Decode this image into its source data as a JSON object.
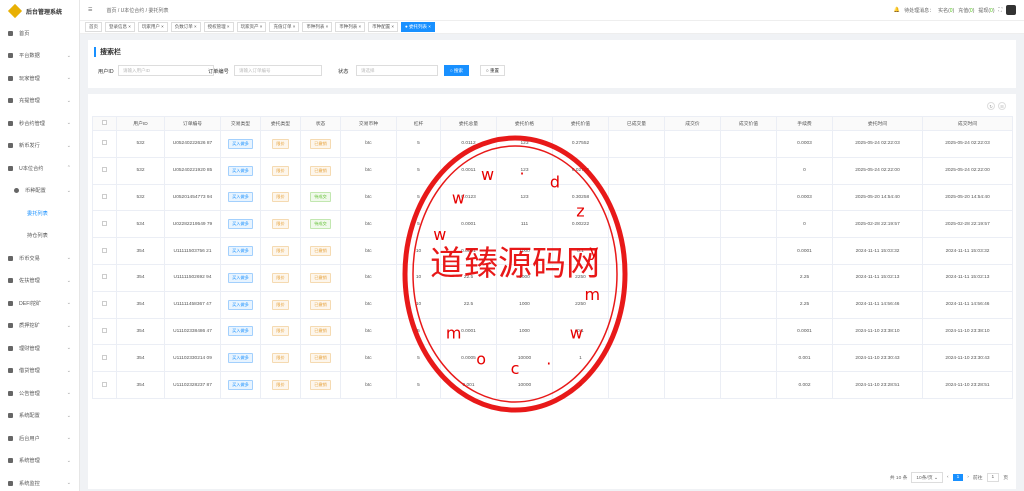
{
  "app": {
    "title": "后台管理系统"
  },
  "sidebar": {
    "items": [
      {
        "label": "首页",
        "arrow": ""
      },
      {
        "label": "平台数据",
        "arrow": "⌄"
      },
      {
        "label": "玩家管理",
        "arrow": "⌄"
      },
      {
        "label": "充提管理",
        "arrow": "⌄"
      },
      {
        "label": "秒合约管理",
        "arrow": "⌄"
      },
      {
        "label": "新币发行",
        "arrow": "⌄"
      },
      {
        "label": "U本位合约",
        "arrow": "⌃"
      },
      {
        "label": "币种配置",
        "arrow": "⌄"
      },
      {
        "label": "委托列表",
        "arrow": ""
      },
      {
        "label": "持仓列表",
        "arrow": ""
      },
      {
        "label": "币币交易",
        "arrow": "⌄"
      },
      {
        "label": "佐扶管理",
        "arrow": "⌄"
      },
      {
        "label": "DEFI挖矿",
        "arrow": "⌄"
      },
      {
        "label": "质押挖矿",
        "arrow": "⌄"
      },
      {
        "label": "理财管理",
        "arrow": "⌄"
      },
      {
        "label": "借贷管理",
        "arrow": "⌄"
      },
      {
        "label": "公告管理",
        "arrow": "⌄"
      },
      {
        "label": "系统配置",
        "arrow": "⌄"
      },
      {
        "label": "后台用户",
        "arrow": "⌄"
      },
      {
        "label": "系统管理",
        "arrow": "⌄"
      },
      {
        "label": "系统监控",
        "arrow": "⌄"
      }
    ]
  },
  "header": {
    "breadcrumb": [
      "首页",
      "U本位合约",
      "委托列表"
    ],
    "pending_label": "待处理消息：",
    "real_label": "实名(",
    "real_count": "0",
    "deposit_label": "充值(",
    "deposit_count": "0",
    "withdraw_label": "提现(",
    "withdraw_count": "0",
    "close_paren": ")"
  },
  "tags": [
    "首页",
    "登录信息 ×",
    "玩家用户 ×",
    "负数订单 ×",
    "授权管理 ×",
    "玩家资产 ×",
    "充值订单 ×",
    "币种列表 ×",
    "币种列表 ×",
    "币种配置 ×",
    "● 委托列表 ×"
  ],
  "search": {
    "title": "搜索栏",
    "user_label": "用户ID",
    "user_placeholder": "请输入用户ID",
    "order_label": "订单编号",
    "order_placeholder": "请输入订单编号",
    "status_label": "状态",
    "status_placeholder": "请选择",
    "search_btn": "○ 搜索",
    "reset_btn": "○ 重置"
  },
  "table": {
    "headers": [
      "",
      "用户ID",
      "订单编号",
      "交易类型",
      "委托类型",
      "状态",
      "交易币种",
      "杠杆",
      "委托总量",
      "委托价格",
      "委托价值",
      "已成交量",
      "成交价",
      "成交价值",
      "手续费",
      "委托时间",
      "成交时间"
    ],
    "rows": [
      [
        "",
        "532",
        "U05240222626 87",
        "买入做多",
        "限价",
        "已撤销",
        "btc",
        "5",
        "0.0112",
        "123",
        "0.27552",
        "",
        "",
        "",
        "0.0003",
        "2025-05-24 02:22:03",
        "2025-05-24 02:22:03"
      ],
      [
        "",
        "532",
        "U05240221920 85",
        "买入做多",
        "限价",
        "已撤销",
        "btc",
        "5",
        "0.0011",
        "123",
        "0.02706",
        "",
        "",
        "",
        "0",
        "2025-05-24 02:22:00",
        "2025-05-24 02:22:00"
      ],
      [
        "",
        "532",
        "U05201454773 94",
        "买入做多",
        "限价",
        "待成交",
        "btc",
        "5",
        "0.0123",
        "123",
        "0.30258",
        "",
        "",
        "",
        "0.0003",
        "2025-05-20 14:54:40",
        "2025-05-20 14:54:40"
      ],
      [
        "",
        "534",
        "U02282219549 79",
        "买入做多",
        "限价",
        "待成交",
        "btc",
        "5",
        "0.0001",
        "111",
        "0.00222",
        "",
        "",
        "",
        "0",
        "2025-02-28 22:19:57",
        "2025-02-28 22:19:57"
      ],
      [
        "",
        "354",
        "U11111503756 21",
        "买入做多",
        "限价",
        "已撤销",
        "btc",
        "10",
        "0.0001",
        "1000",
        "0.1",
        "",
        "",
        "",
        "0.0001",
        "2024-11-11 15:03:32",
        "2024-11-11 15:03:32"
      ],
      [
        "",
        "354",
        "U11111502692 94",
        "买入做多",
        "限价",
        "已撤销",
        "btc",
        "10",
        "22.5",
        "1000",
        "2250",
        "",
        "",
        "",
        "2.25",
        "2024-11-11 15:02:13",
        "2024-11-11 15:02:13"
      ],
      [
        "",
        "354",
        "U11111458367 47",
        "买入做多",
        "限价",
        "已撤销",
        "btc",
        "10",
        "22.5",
        "1000",
        "2250",
        "",
        "",
        "",
        "2.25",
        "2024-11-11 14:56:46",
        "2024-11-11 14:56:46"
      ],
      [
        "",
        "354",
        "U11102338486 47",
        "买入做多",
        "限价",
        "已撤销",
        "btc",
        "5",
        "0.0001",
        "1000",
        "0.1",
        "",
        "",
        "",
        "0.0001",
        "2024-11-10 23:38:10",
        "2024-11-10 23:38:10"
      ],
      [
        "",
        "354",
        "U11102330214 09",
        "买入做多",
        "限价",
        "已撤销",
        "btc",
        "5",
        "0.0005",
        "10000",
        "1",
        "",
        "",
        "",
        "0.001",
        "2024-11-10 23:30:43",
        "2024-11-10 23:30:43"
      ],
      [
        "",
        "354",
        "U11102328237 87",
        "买入做多",
        "限价",
        "已撤销",
        "btc",
        "5",
        "0.001",
        "10000",
        "2",
        "",
        "",
        "",
        "0.002",
        "2024-11-10 23:28:51",
        "2024-11-10 23:28:51"
      ]
    ]
  },
  "pager": {
    "total": "共 10 条",
    "size": "10条/页 ⌄",
    "prev": "‹",
    "page": "1",
    "next": "›",
    "goto_label": "前往",
    "goto_value": "1",
    "goto_unit": "页"
  },
  "watermark": {
    "cn": "道臻源码网",
    "url": "www.dzymw.com"
  },
  "colors": {
    "accent": "#1890ff",
    "stamp": "#e60000"
  }
}
